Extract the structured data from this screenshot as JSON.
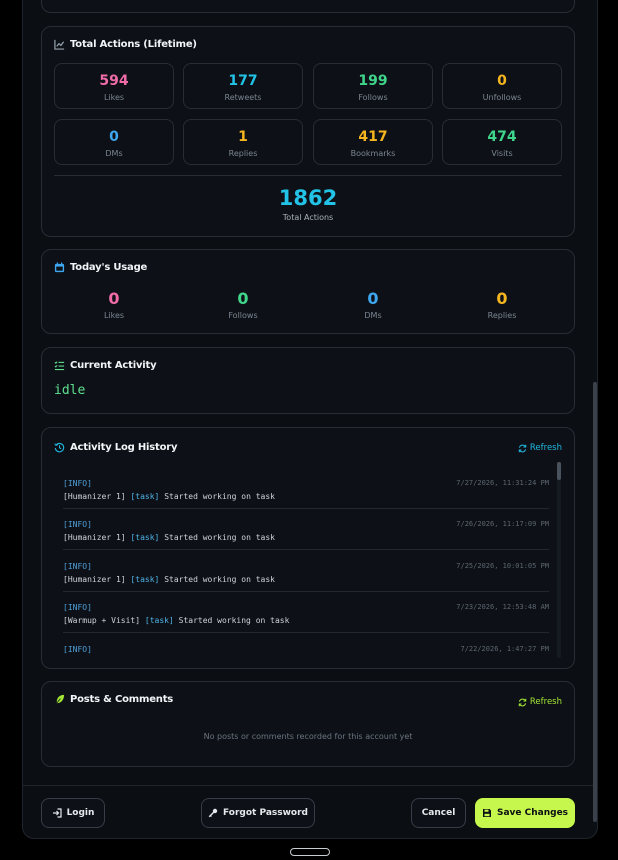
{
  "lifetime": {
    "title": "Total Actions (Lifetime)",
    "stats": [
      {
        "label": "Likes",
        "value": "594",
        "color": "#f06ba8"
      },
      {
        "label": "Retweets",
        "value": "177",
        "color": "#22c3e6"
      },
      {
        "label": "Follows",
        "value": "199",
        "color": "#3fd68c"
      },
      {
        "label": "Unfollows",
        "value": "0",
        "color": "#f5b51f"
      },
      {
        "label": "DMs",
        "value": "0",
        "color": "#3fa7f0"
      },
      {
        "label": "Replies",
        "value": "1",
        "color": "#f5b51f"
      },
      {
        "label": "Bookmarks",
        "value": "417",
        "color": "#f5b51f"
      },
      {
        "label": "Visits",
        "value": "474",
        "color": "#3fd68c"
      }
    ],
    "total_value": "1862",
    "total_label": "Total Actions"
  },
  "today": {
    "title": "Today's Usage",
    "stats": [
      {
        "label": "Likes",
        "value": "0",
        "color": "#f06ba8"
      },
      {
        "label": "Follows",
        "value": "0",
        "color": "#3fd68c"
      },
      {
        "label": "DMs",
        "value": "0",
        "color": "#3fa7f0"
      },
      {
        "label": "Replies",
        "value": "0",
        "color": "#f5b51f"
      }
    ]
  },
  "activity": {
    "title": "Current Activity",
    "value": "idle"
  },
  "log": {
    "title": "Activity Log History",
    "refresh_label": "Refresh",
    "entries": [
      {
        "level": "[INFO]",
        "source": "[Humanizer 1]",
        "category": "[task]",
        "message": "Started working on task",
        "timestamp": "7/27/2026, 11:31:24 PM"
      },
      {
        "level": "[INFO]",
        "source": "[Humanizer 1]",
        "category": "[task]",
        "message": "Started working on task",
        "timestamp": "7/26/2026, 11:17:09 PM"
      },
      {
        "level": "[INFO]",
        "source": "[Humanizer 1]",
        "category": "[task]",
        "message": "Started working on task",
        "timestamp": "7/25/2026, 10:01:05 PM"
      },
      {
        "level": "[INFO]",
        "source": "[Warmup + Visit]",
        "category": "[task]",
        "message": "Started working on task",
        "timestamp": "7/23/2026, 12:53:48 AM"
      },
      {
        "level": "[INFO]",
        "source": "",
        "category": "",
        "message": "",
        "timestamp": "7/22/2026, 1:47:27 PM"
      }
    ]
  },
  "posts": {
    "title": "Posts & Comments",
    "refresh_label": "Refresh",
    "empty_text": "No posts or comments recorded for this account yet"
  },
  "footer": {
    "login_label": "Login",
    "forgot_label": "Forgot Password",
    "cancel_label": "Cancel",
    "save_label": "Save Changes"
  },
  "colors": {
    "accent_green": "#c6f74d",
    "activity_green": "#5ee08f",
    "posts_accent": "#a3e635",
    "log_refresh": "#22b8e0"
  }
}
